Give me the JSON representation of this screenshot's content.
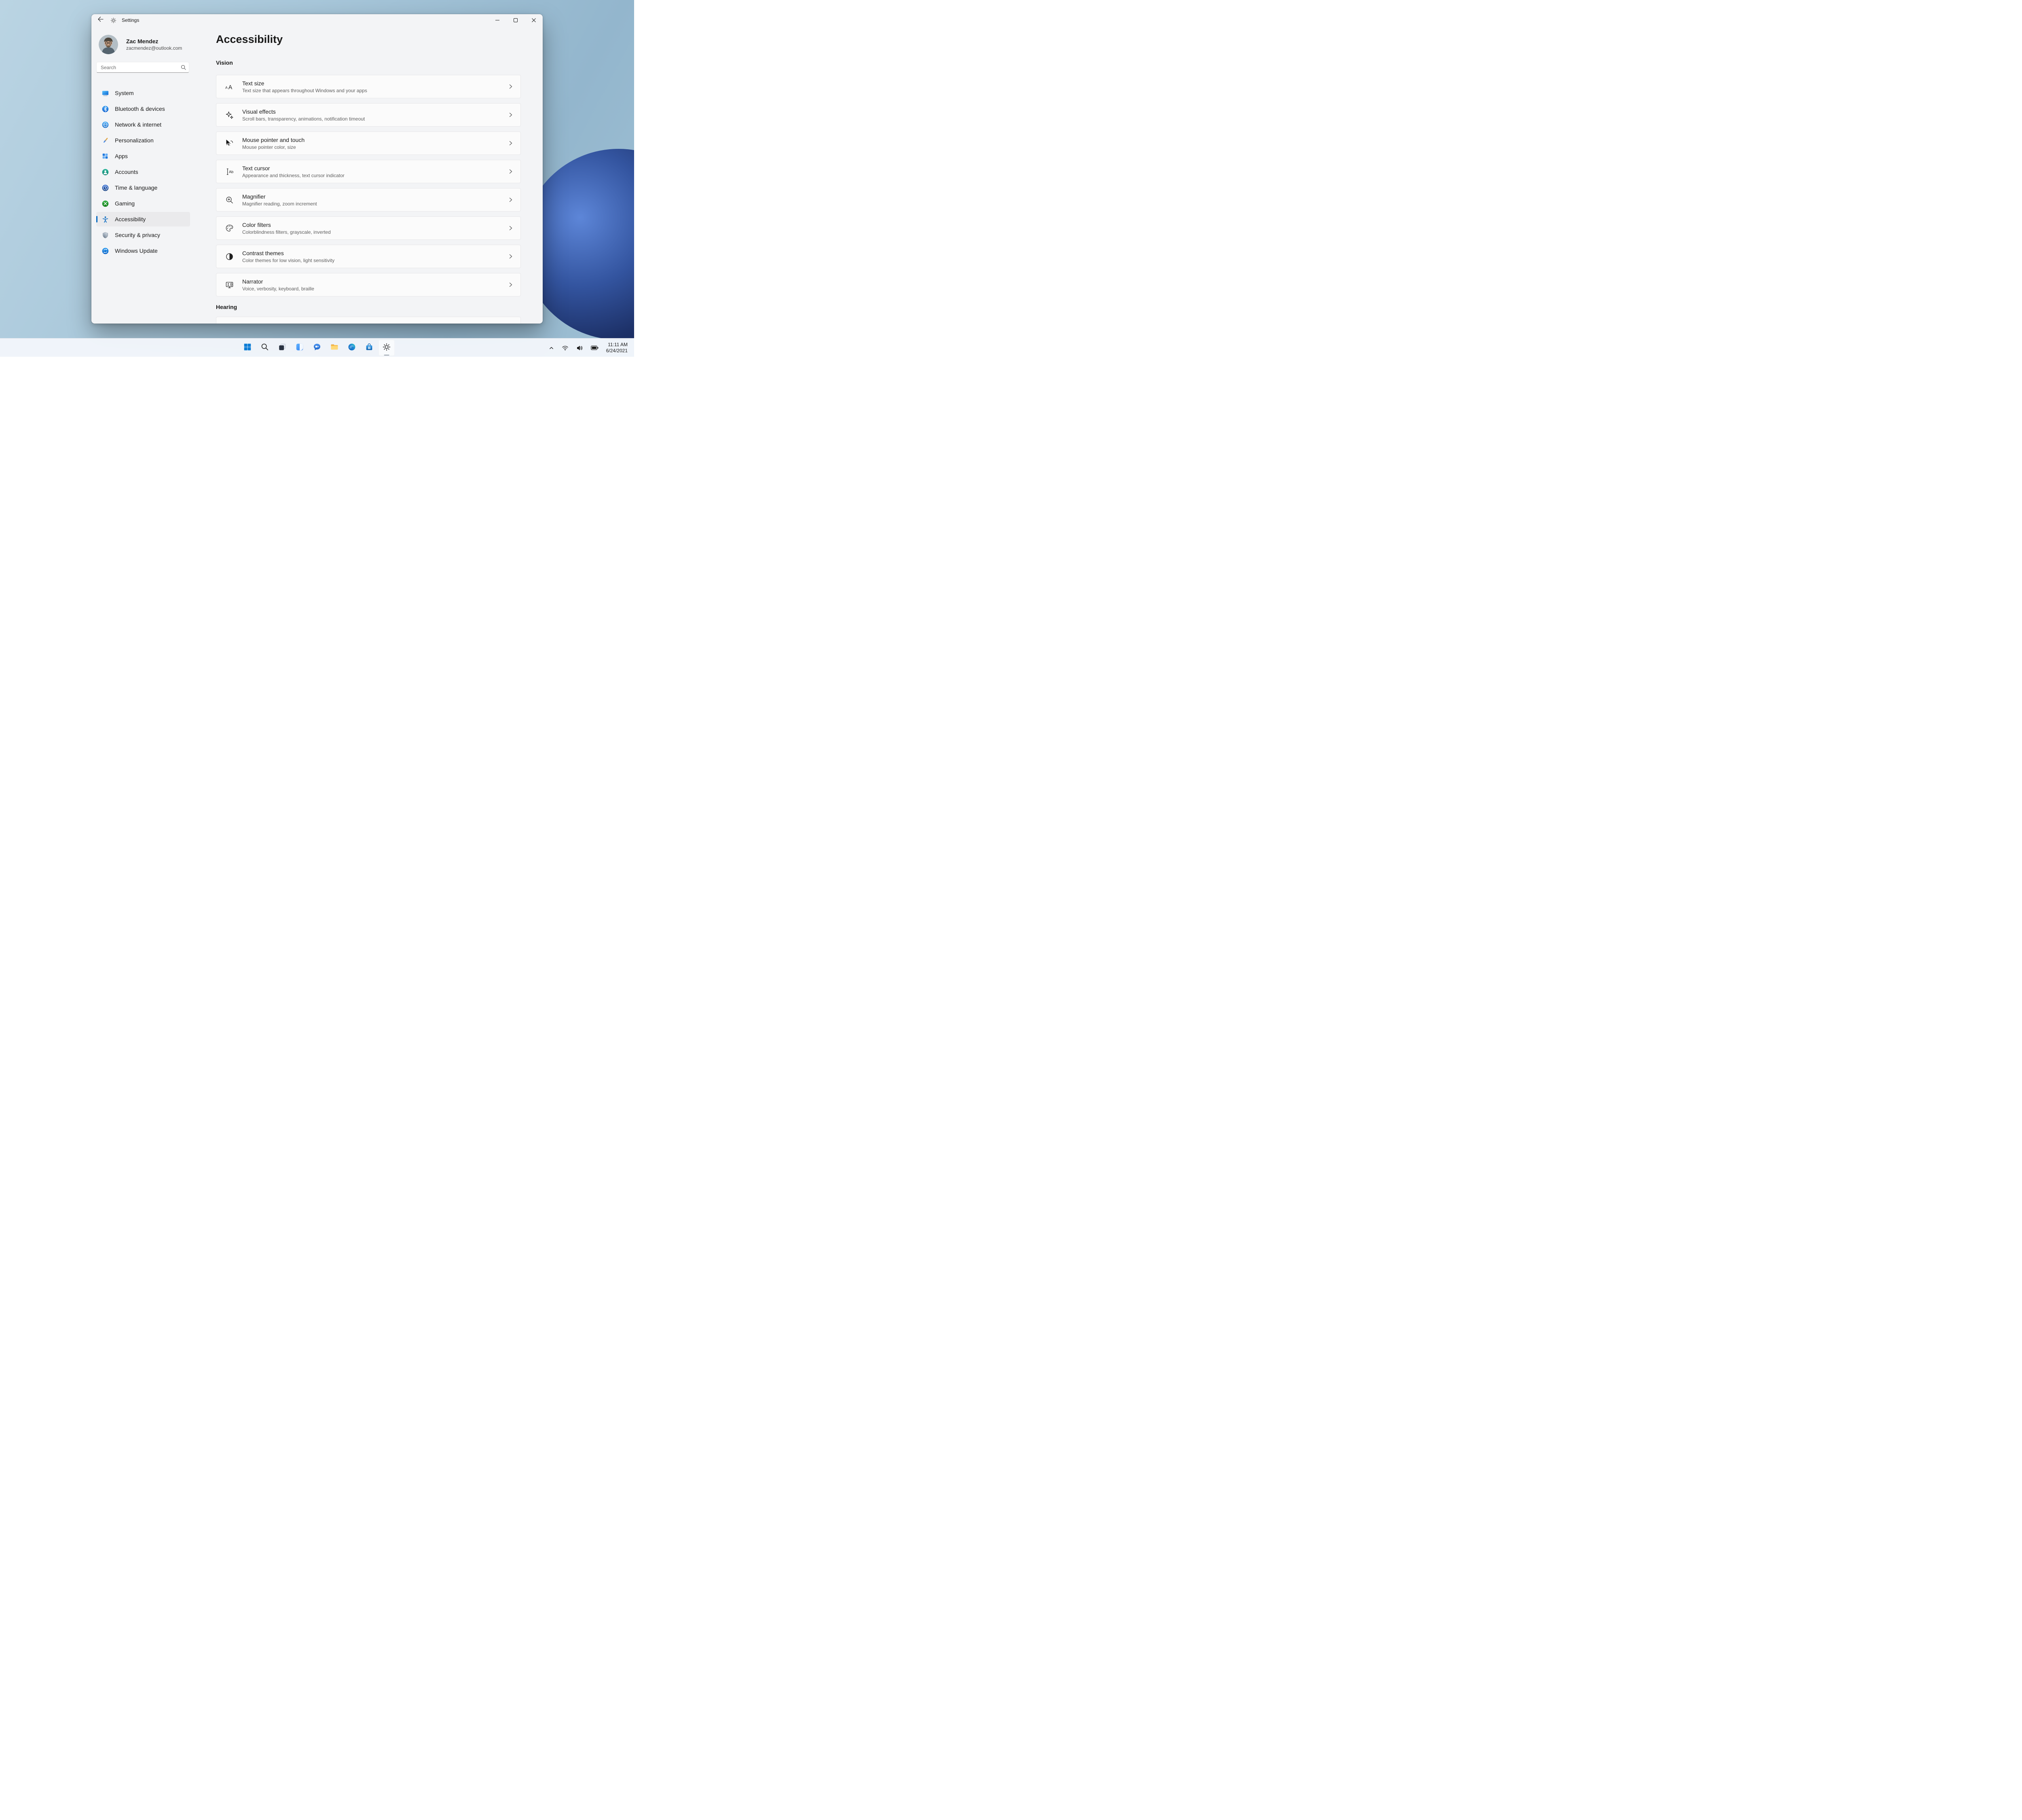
{
  "window": {
    "title": "Settings"
  },
  "user": {
    "name": "Zac Mendez",
    "email": "zacmendez@outlook.com"
  },
  "search": {
    "placeholder": "Search"
  },
  "sidebar": {
    "items": [
      {
        "label": "System",
        "icon": "system-icon"
      },
      {
        "label": "Bluetooth & devices",
        "icon": "bluetooth-icon"
      },
      {
        "label": "Network & internet",
        "icon": "network-icon"
      },
      {
        "label": "Personalization",
        "icon": "personalization-icon"
      },
      {
        "label": "Apps",
        "icon": "apps-icon"
      },
      {
        "label": "Accounts",
        "icon": "accounts-icon"
      },
      {
        "label": "Time & language",
        "icon": "time-language-icon"
      },
      {
        "label": "Gaming",
        "icon": "gaming-icon"
      },
      {
        "label": "Accessibility",
        "icon": "accessibility-icon",
        "selected": true
      },
      {
        "label": "Security & privacy",
        "icon": "security-icon"
      },
      {
        "label": "Windows Update",
        "icon": "windows-update-icon"
      }
    ]
  },
  "main": {
    "title": "Accessibility",
    "sections": [
      {
        "label": "Vision",
        "items": [
          {
            "title": "Text size",
            "description": "Text size that appears throughout Windows and your apps",
            "icon": "text-size-icon"
          },
          {
            "title": "Visual effects",
            "description": "Scroll bars, transparency, animations, notification timeout",
            "icon": "visual-effects-icon"
          },
          {
            "title": "Mouse pointer and touch",
            "description": "Mouse pointer color, size",
            "icon": "mouse-pointer-touch-icon"
          },
          {
            "title": "Text cursor",
            "description": "Appearance and thickness, text cursor indicator",
            "icon": "text-cursor-icon"
          },
          {
            "title": "Magnifier",
            "description": "Magnifier reading, zoom increment",
            "icon": "magnifier-icon"
          },
          {
            "title": "Color filters",
            "description": "Colorblindness filters, grayscale, inverted",
            "icon": "color-filters-icon"
          },
          {
            "title": "Contrast themes",
            "description": "Color themes for low vision, light sensitivity",
            "icon": "contrast-themes-icon"
          },
          {
            "title": "Narrator",
            "description": "Voice, verbosity, keyboard, braille",
            "icon": "narrator-icon"
          }
        ]
      },
      {
        "label": "Hearing",
        "items": []
      }
    ]
  },
  "taskbar": {
    "apps": [
      {
        "name": "start"
      },
      {
        "name": "search"
      },
      {
        "name": "task-view"
      },
      {
        "name": "widgets"
      },
      {
        "name": "chat"
      },
      {
        "name": "file-explorer"
      },
      {
        "name": "edge"
      },
      {
        "name": "store"
      },
      {
        "name": "settings",
        "active": true
      }
    ],
    "tray": {
      "time": "11:11 AM",
      "date": "6/24/2021"
    }
  },
  "glyphs": {
    "a_small": "A",
    "a_large": "A",
    "ab": "Ab"
  },
  "colors": {
    "accent": "#0067c0"
  }
}
